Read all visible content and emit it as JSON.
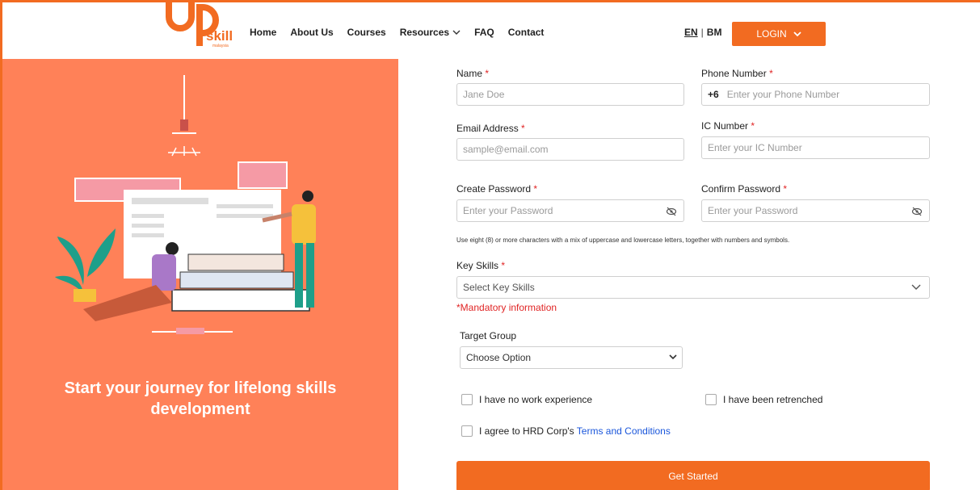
{
  "logo": {
    "brand": "skill",
    "sub": "malaysia"
  },
  "nav": {
    "items": [
      "Home",
      "About Us",
      "Courses",
      "Resources",
      "FAQ",
      "Contact"
    ]
  },
  "lang": {
    "en": "EN",
    "separator": "|",
    "bm": "BM"
  },
  "login": {
    "label": "LOGIN"
  },
  "left": {
    "tagline": "Start your journey for lifelong skills development"
  },
  "form": {
    "name": {
      "label": "Name",
      "placeholder": "Jane Doe"
    },
    "phone": {
      "label": "Phone Number",
      "prefix": "+6",
      "placeholder": "Enter your Phone Number"
    },
    "email": {
      "label": "Email Address",
      "placeholder": "sample@email.com"
    },
    "ic": {
      "label": "IC Number",
      "placeholder": "Enter your IC Number"
    },
    "password": {
      "label": "Create Password",
      "placeholder": "Enter your Password"
    },
    "confirm": {
      "label": "Confirm Password",
      "placeholder": "Enter your Password"
    },
    "password_hint": "Use eight (8) or more characters with a mix of uppercase and lowercase letters, together with numbers and symbols.",
    "key_skills": {
      "label": "Key Skills",
      "placeholder": "Select Key Skills",
      "error": "*Mandatory information"
    },
    "target_group": {
      "label": "Target Group",
      "placeholder": "Choose Option"
    },
    "required_mark": "*",
    "checkboxes": {
      "no_experience": "I have no work experience",
      "retrenched": "I have been retrenched",
      "agree_prefix": "I agree to HRD Corp's ",
      "agree_link": "Terms and Conditions"
    },
    "submit": "Get Started"
  },
  "colors": {
    "accent": "#f26b21",
    "panel": "#ff8158",
    "error": "#e02424",
    "link": "#1a56db"
  }
}
